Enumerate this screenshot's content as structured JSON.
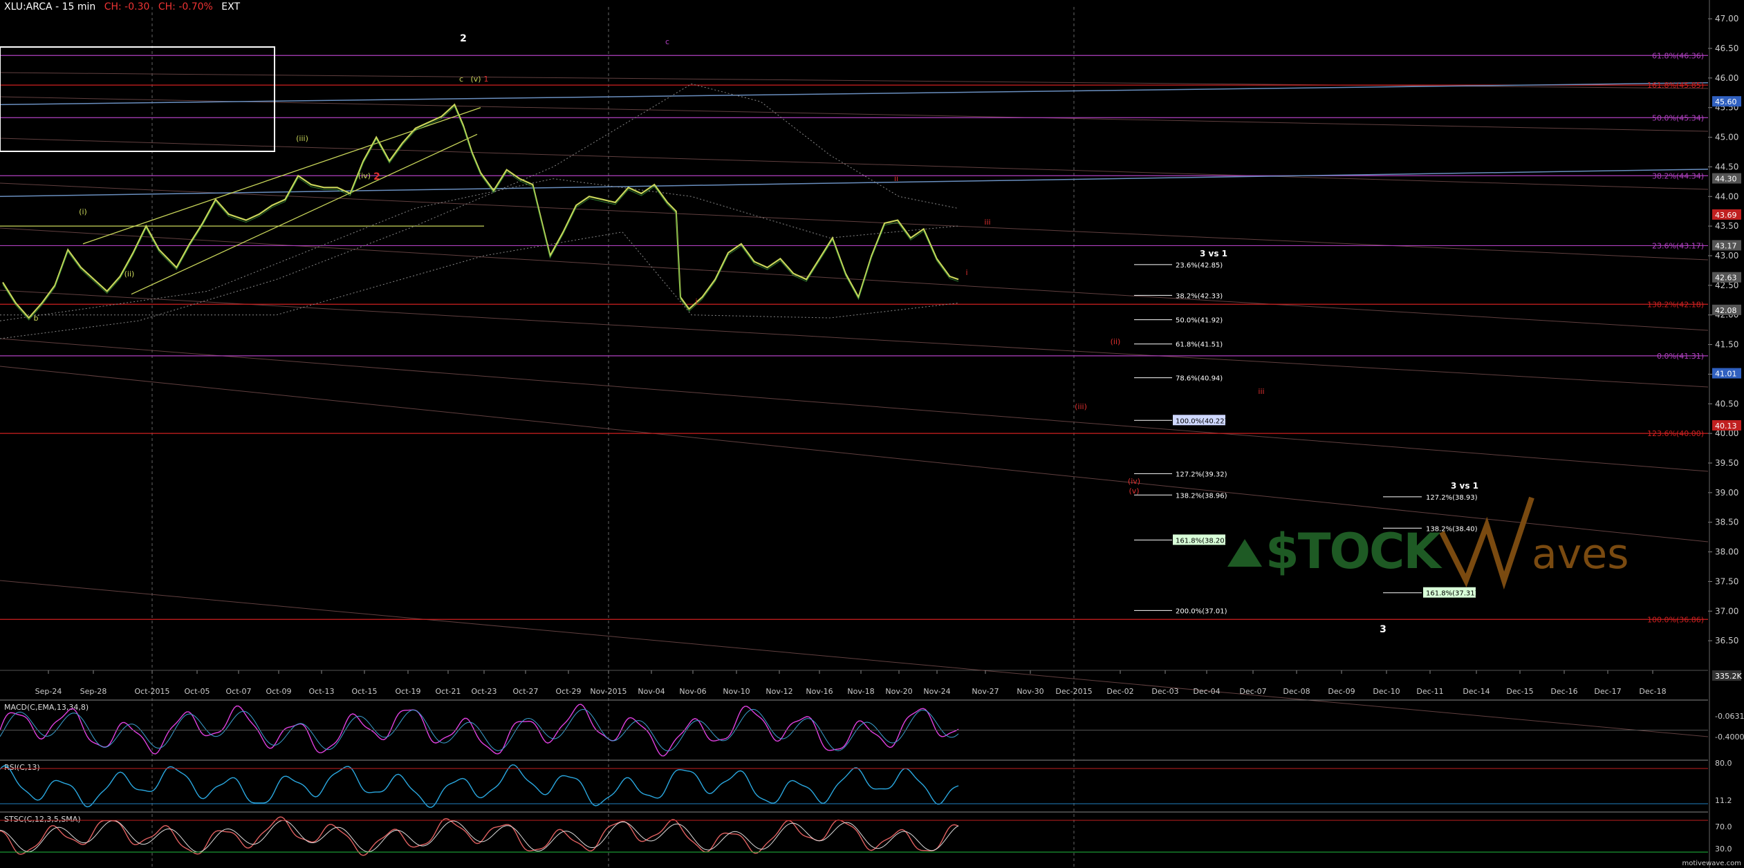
{
  "header": {
    "symbol": "XLU:ARCA - 15 min",
    "change": "CH: -0.30",
    "change_pct": "CH: -0.70%",
    "ext": "EXT"
  },
  "colors": {
    "background": "#000000",
    "price": "#c9d65a",
    "fib_red": "#d02020",
    "fib_magenta": "#b040c0",
    "trend_blue": "#6a8fc0",
    "macd": "#e040e0",
    "rsi": "#2aa8e0",
    "stoch": "#e06060",
    "watermark_green": "#1e5a24",
    "watermark_brown": "#7a4a10"
  },
  "chart_data": {
    "type": "line",
    "title": "XLU:ARCA - 15 min",
    "x_ticks": [
      "Sep-24",
      "Sep-28",
      "Oct-2015",
      "Oct-05",
      "Oct-07",
      "Oct-09",
      "Oct-13",
      "Oct-15",
      "Oct-19",
      "Oct-21",
      "Oct-23",
      "Oct-27",
      "Oct-29",
      "Nov-2015",
      "Nov-04",
      "Nov-06",
      "Nov-10",
      "Nov-12",
      "Nov-16",
      "Nov-18",
      "Nov-20",
      "Nov-24",
      "Nov-27",
      "Nov-30",
      "Dec-2015",
      "Dec-02",
      "Dec-03",
      "Dec-04",
      "Dec-07",
      "Dec-08",
      "Dec-09",
      "Dec-10",
      "Dec-11",
      "Dec-14",
      "Dec-15",
      "Dec-16",
      "Dec-17",
      "Dec-18"
    ],
    "y_ticks": [
      "47.00",
      "46.50",
      "46.00",
      "45.50",
      "45.00",
      "44.50",
      "44.00",
      "43.50",
      "43.00",
      "42.50",
      "42.00",
      "41.50",
      "41.00",
      "40.50",
      "40.00",
      "39.50",
      "39.00",
      "38.50",
      "38.00",
      "37.50",
      "37.00",
      "36.50"
    ],
    "ylim": [
      36.0,
      47.2
    ],
    "price_path": [
      [
        0,
        42.55
      ],
      [
        3,
        42.2
      ],
      [
        6,
        41.95
      ],
      [
        9,
        42.2
      ],
      [
        12,
        42.5
      ],
      [
        15,
        43.1
      ],
      [
        18,
        42.8
      ],
      [
        21,
        42.6
      ],
      [
        24,
        42.4
      ],
      [
        27,
        42.65
      ],
      [
        30,
        43.05
      ],
      [
        33,
        43.5
      ],
      [
        36,
        43.1
      ],
      [
        40,
        42.8
      ],
      [
        43,
        43.2
      ],
      [
        46,
        43.55
      ],
      [
        49,
        43.95
      ],
      [
        52,
        43.7
      ],
      [
        56,
        43.6
      ],
      [
        59,
        43.7
      ],
      [
        62,
        43.85
      ],
      [
        65,
        43.95
      ],
      [
        68,
        44.35
      ],
      [
        71,
        44.2
      ],
      [
        74,
        44.15
      ],
      [
        77,
        44.15
      ],
      [
        80,
        44.05
      ],
      [
        83,
        44.6
      ],
      [
        86,
        45.0
      ],
      [
        89,
        44.6
      ],
      [
        92,
        44.9
      ],
      [
        95,
        45.15
      ],
      [
        98,
        45.25
      ],
      [
        101,
        45.35
      ],
      [
        104,
        45.55
      ],
      [
        106,
        45.2
      ],
      [
        108,
        44.75
      ],
      [
        110,
        44.4
      ],
      [
        113,
        44.1
      ],
      [
        116,
        44.45
      ],
      [
        119,
        44.3
      ],
      [
        122,
        44.2
      ],
      [
        124,
        43.6
      ],
      [
        126,
        43.0
      ],
      [
        129,
        43.4
      ],
      [
        132,
        43.85
      ],
      [
        135,
        44.0
      ],
      [
        138,
        43.95
      ],
      [
        141,
        43.9
      ],
      [
        144,
        44.15
      ],
      [
        147,
        44.05
      ],
      [
        150,
        44.2
      ],
      [
        153,
        43.9
      ],
      [
        155,
        43.75
      ],
      [
        156,
        42.3
      ],
      [
        158,
        42.1
      ],
      [
        161,
        42.3
      ],
      [
        164,
        42.6
      ],
      [
        167,
        43.05
      ],
      [
        170,
        43.2
      ],
      [
        173,
        42.9
      ],
      [
        176,
        42.8
      ],
      [
        179,
        42.95
      ],
      [
        182,
        42.7
      ],
      [
        185,
        42.6
      ],
      [
        188,
        42.95
      ],
      [
        191,
        43.3
      ],
      [
        194,
        42.7
      ],
      [
        197,
        42.3
      ],
      [
        200,
        43.0
      ],
      [
        203,
        43.55
      ],
      [
        206,
        43.6
      ],
      [
        209,
        43.3
      ],
      [
        212,
        43.45
      ],
      [
        215,
        42.95
      ],
      [
        218,
        42.65
      ],
      [
        220,
        42.6
      ]
    ],
    "price_labels": [
      "45.60",
      "44.30",
      "43.69",
      "43.17",
      "42.63",
      "42.08",
      "41.01",
      "40.13",
      "335.2K"
    ],
    "fib_table_1": {
      "title": "3 vs 1",
      "items": [
        {
          "label": "23.6%(42.85)",
          "price": 42.85
        },
        {
          "label": "38.2%(42.33)",
          "price": 42.33
        },
        {
          "label": "50.0%(41.92)",
          "price": 41.92
        },
        {
          "label": "61.8%(41.51)",
          "price": 41.51
        },
        {
          "label": "78.6%(40.94)",
          "price": 40.94
        },
        {
          "label": "100.0%(40.22)",
          "price": 40.22
        },
        {
          "label": "127.2%(39.32)",
          "price": 39.32
        },
        {
          "label": "138.2%(38.96)",
          "price": 38.96
        },
        {
          "label": "161.8%(38.20)",
          "price": 38.2
        },
        {
          "label": "200.0%(37.01)",
          "price": 37.01
        }
      ]
    },
    "fib_table_2": {
      "title": "3 vs 1",
      "items": [
        {
          "label": "127.2%(38.93)",
          "price": 38.93
        },
        {
          "label": "138.2%(38.40)",
          "price": 38.4
        },
        {
          "label": "161.8%(37.31)",
          "price": 37.31
        }
      ]
    },
    "right_fib_labels": [
      {
        "label": "61.8%(46.36)",
        "price": 46.38
      },
      {
        "label": "161.8%(45.85)",
        "price": 45.88
      },
      {
        "label": "50.0%(45.34)",
        "price": 45.33
      },
      {
        "label": "38.2%(44.34)",
        "price": 44.35
      },
      {
        "label": "23.6%(43.17)",
        "price": 43.17
      },
      {
        "label": "138.2%(42.18)",
        "price": 42.18
      },
      {
        "label": "0.0%(41.31)",
        "price": 41.31
      },
      {
        "label": "123.6%(40.00)",
        "price": 40.0
      },
      {
        "label": "100.0%(36.86)",
        "price": 36.86
      }
    ],
    "wave_labels": [
      "2",
      "c",
      "(v)",
      "1",
      "(iii)",
      "(iv)",
      "2",
      "(i)",
      "(ii)",
      "b",
      "i",
      "ii",
      "iii",
      "i",
      "c",
      "(ii)",
      "iii",
      "(iii)",
      "(iv)",
      "(v)",
      "3"
    ],
    "indicators": {
      "macd": {
        "name": "MACD(C,EMA,13,34,8)",
        "values": [
          "-0.0631",
          "-0.4000"
        ]
      },
      "rsi": {
        "name": "RSI(C,13)",
        "values": [
          "80.0",
          "11.2"
        ]
      },
      "stoch": {
        "name": "STSC(C,12,3,5,SMA)",
        "values": [
          "70.0",
          "30.0"
        ]
      }
    }
  },
  "watermark": {
    "left": "$TOCK",
    "right": "aves"
  },
  "footer": {
    "site": "motivewave.com"
  }
}
